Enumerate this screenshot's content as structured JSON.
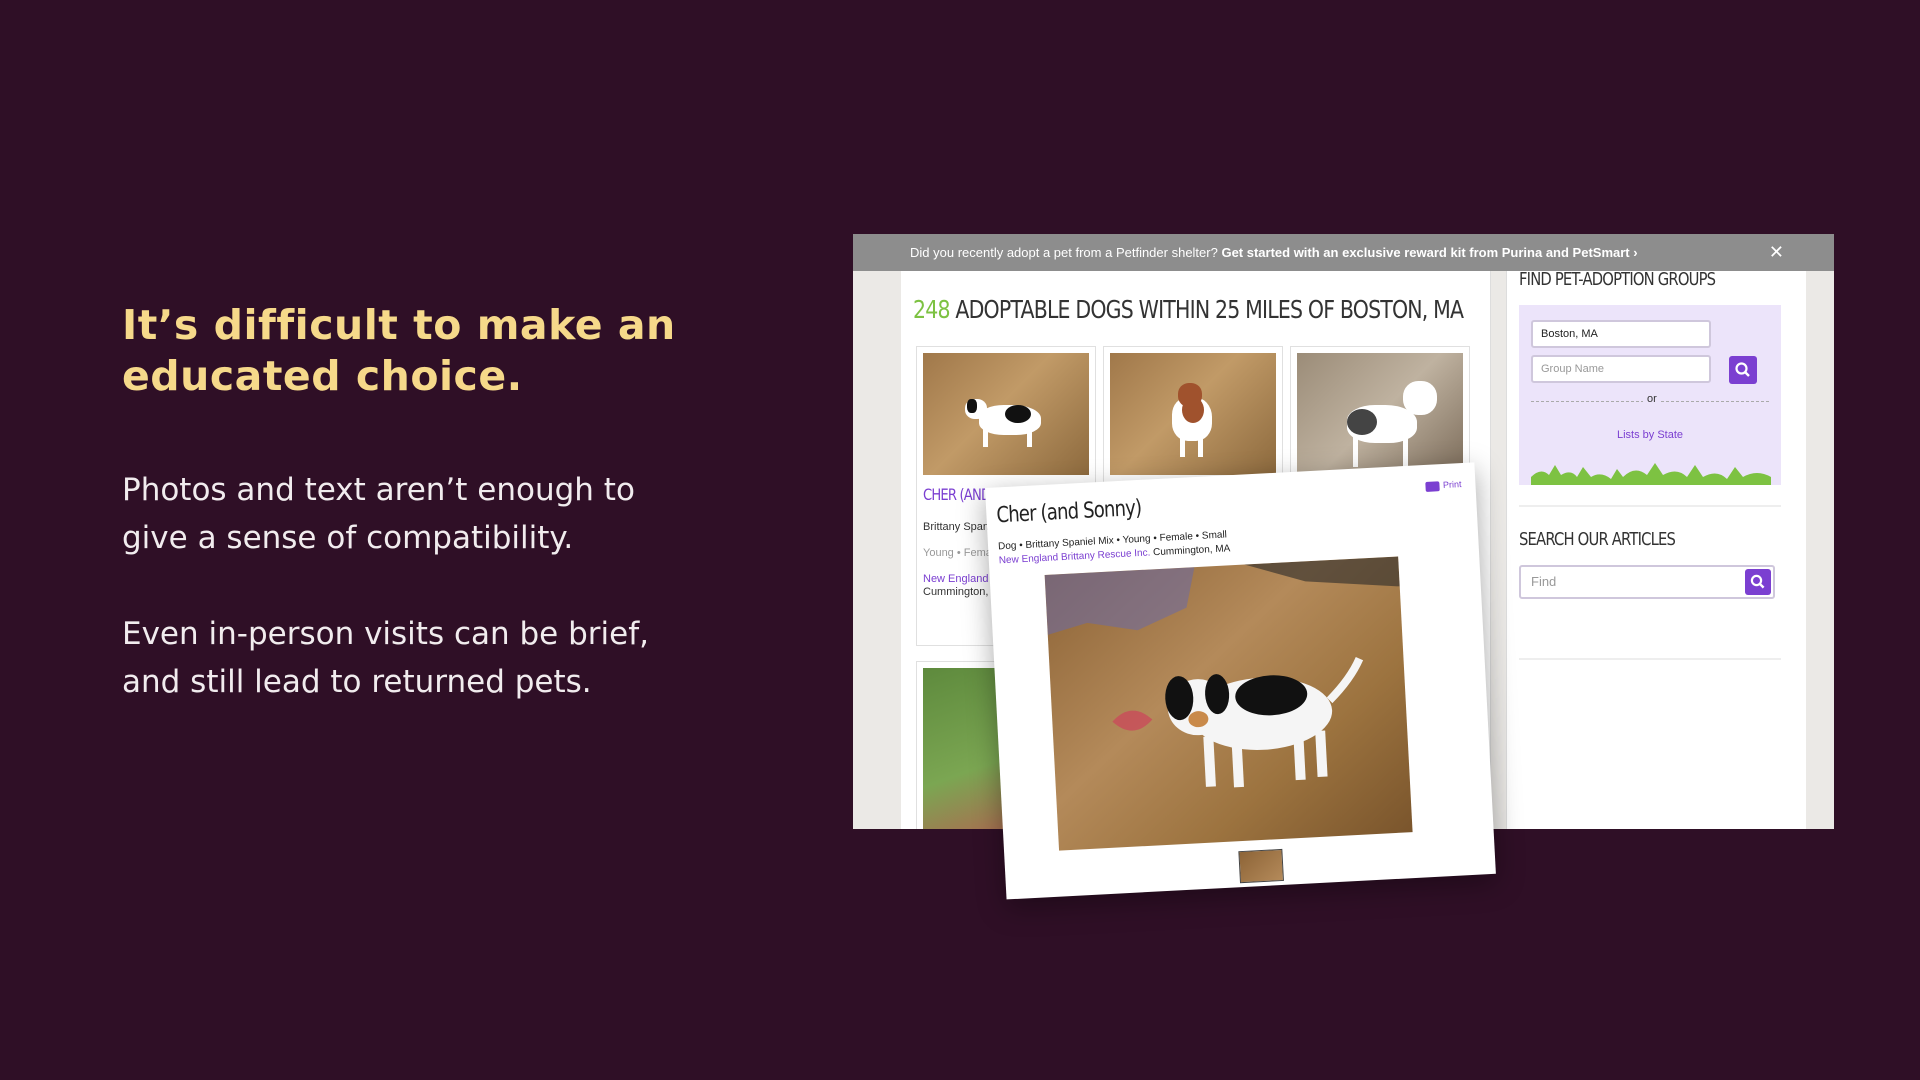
{
  "slide": {
    "title": "It’s difficult to make an educated choice.",
    "paragraph1": "Photos and text aren’t enough to give a sense of compatibility.",
    "paragraph2": "Even in-person visits can be brief, and still lead to returned pets."
  },
  "banner": {
    "text": "Did you recently adopt a pet from a Petfinder shelter? ",
    "cta": "Get started with an exclusive reward kit from Purina and PetSmart ›",
    "close": "✕"
  },
  "results": {
    "count": "248",
    "heading": " ADOPTABLE DOGS WITHIN 25 MILES OF BOSTON, MA",
    "cards": [
      {
        "name": "CHER (AND SONNY)",
        "breed": "Brittany Spaniel Mix",
        "age_sex": "Young • Female",
        "org": "New England Brittany Rescue Inc.",
        "location": "Cummington, MA"
      }
    ]
  },
  "sidebar": {
    "groups_heading": "FIND PET-ADOPTION GROUPS",
    "location_value": "Boston, MA",
    "group_placeholder": "Group Name",
    "or_text": "or",
    "state_link": "Lists by State",
    "articles_heading": "SEARCH OUR ARTICLES",
    "find_placeholder": "Find"
  },
  "popup": {
    "title": "Cher (and Sonny)",
    "meta": "Dog • Brittany Spaniel Mix • Young • Female • Small",
    "org_link": "New England Brittany Rescue Inc.",
    "location": " Cummington, MA",
    "print": "Print"
  },
  "colors": {
    "background": "#2f0f26",
    "title": "#f6d98a",
    "accent_purple": "#7b3fd1",
    "accent_green": "#7dc242"
  }
}
